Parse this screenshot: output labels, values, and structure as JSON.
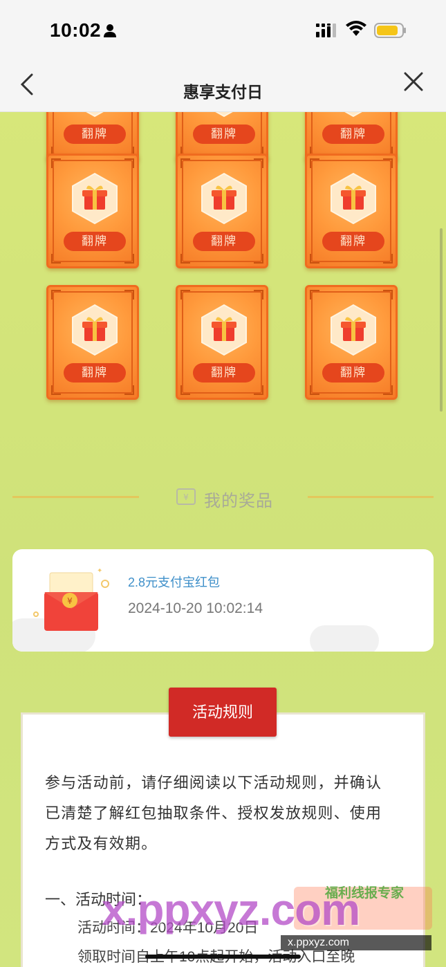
{
  "status_bar": {
    "time": "10:02",
    "icons": [
      "person-icon",
      "signal-icon",
      "wifi-icon",
      "battery-icon"
    ],
    "battery_color": "#f5c518"
  },
  "nav": {
    "title": "惠享支付日",
    "back_icon": "chevron-left-icon",
    "close_icon": "close-icon"
  },
  "cards": {
    "button_label": "翻牌",
    "count_visible": 9,
    "colors": {
      "card": "#ff9a3c",
      "button": "#e5461d"
    }
  },
  "prizes": {
    "section_title": "我的奖品",
    "items": [
      {
        "name": "2.8元支付宝红包",
        "time": "2024-10-20 10:02:14"
      }
    ]
  },
  "rules": {
    "tab_label": "活动规则",
    "intro_lines": [
      "参与活动前，请仔细阅读以下活动规则，并确认",
      "已清楚了解红包抽取条件、授权发放规则、使用",
      "方式及有效期。"
    ],
    "section1_heading": "一、活动时间：",
    "section1_line1": "活动时间：2024年10月20日",
    "section1_line2": "领取时间自上午10点起开始，活动入口至晚"
  },
  "watermark": {
    "big_text": "x.ppxyz.com",
    "brand_text": "福利线报专家",
    "small_text": "x.ppxyz.com"
  }
}
